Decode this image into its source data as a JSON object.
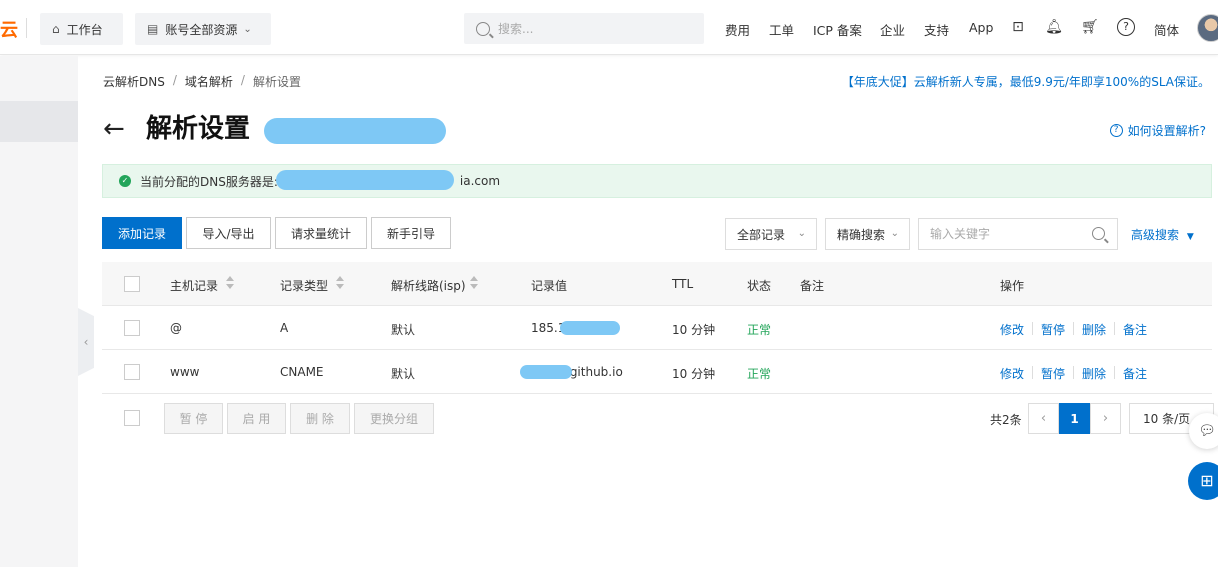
{
  "topbar": {
    "logo": "云",
    "workbench": "工作台",
    "resources": "账号全部资源",
    "search_placeholder": "搜索...",
    "nav": [
      "费用",
      "工单",
      "ICP 备案",
      "企业",
      "支持",
      "App"
    ],
    "lang": "简体"
  },
  "breadcrumb": [
    "云解析DNS",
    "域名解析",
    "解析设置"
  ],
  "promo": "【年底大促】云解析新人专属，最低9.9元/年即享100%的SLA保证。",
  "page": {
    "title": "解析设置",
    "help": "如何设置解析?"
  },
  "banner": {
    "label": "当前分配的DNS服务器是:",
    "server_suffix": "ia.com"
  },
  "toolbar": {
    "add": "添加记录",
    "import_export": "导入/导出",
    "stats": "请求量统计",
    "guide": "新手引导",
    "filter_all": "全部记录",
    "precise": "精确搜索",
    "keyword_placeholder": "输入关键字",
    "advanced": "高级搜索"
  },
  "table": {
    "headers": {
      "host": "主机记录",
      "type": "记录类型",
      "line": "解析线路(isp)",
      "value": "记录值",
      "ttl": "TTL",
      "status": "状态",
      "remark": "备注",
      "ops": "操作"
    },
    "rows": [
      {
        "host": "@",
        "type": "A",
        "line": "默认",
        "value": "185.1",
        "ttl": "10 分钟",
        "status": "正常"
      },
      {
        "host": "www",
        "type": "CNAME",
        "line": "默认",
        "value": ".github.io",
        "ttl": "10 分钟",
        "status": "正常"
      }
    ],
    "actions": [
      "修改",
      "暂停",
      "删除",
      "备注"
    ]
  },
  "footer": {
    "pause": "暂 停",
    "enable": "启 用",
    "delete": "删 除",
    "change_group": "更换分组",
    "total": "共2条",
    "current_page": "1",
    "page_size": "10 条/页"
  },
  "colors": {
    "accent": "#0070cc",
    "ok": "#23a55a",
    "brand": "#ff6a00"
  }
}
